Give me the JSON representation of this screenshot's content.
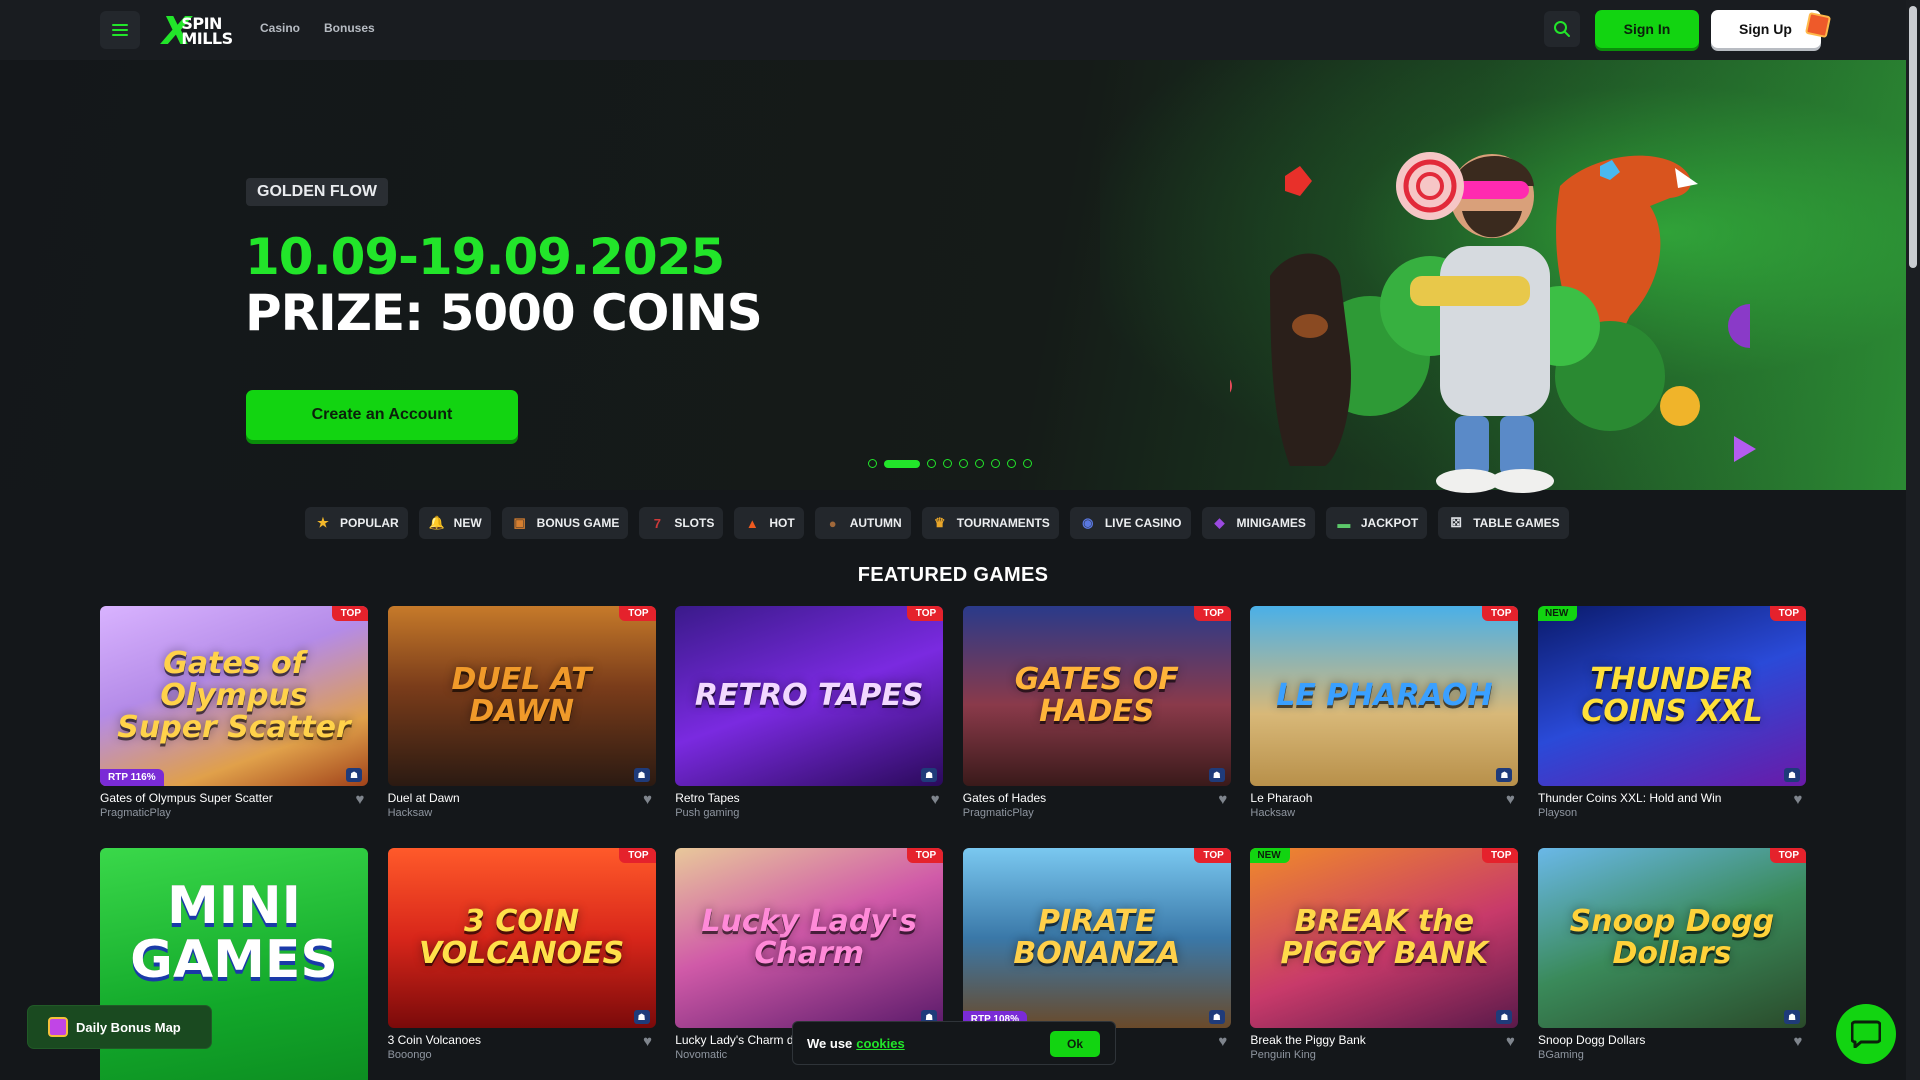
{
  "header": {
    "logo_line1": "SPIN",
    "logo_line2": "MILLS",
    "nav": [
      "Casino",
      "Bonuses"
    ],
    "signin_label": "Sign In",
    "signup_label": "Sign Up"
  },
  "hero": {
    "tag": "GOLDEN FLOW",
    "dates": "10.09-19.09.2025",
    "prize": "PRIZE: 5000 COINS",
    "cta": "Create an Account",
    "slides_total": 9,
    "active_slide": 2
  },
  "categories": [
    {
      "label": "POPULAR",
      "icon": "star-icon",
      "glyph": "★",
      "color": "#f2b72a"
    },
    {
      "label": "NEW",
      "icon": "bell-icon",
      "glyph": "🔔",
      "color": "#e8b040"
    },
    {
      "label": "BONUS GAME",
      "icon": "treasure-chest-icon",
      "glyph": "▣",
      "color": "#d67f30"
    },
    {
      "label": "SLOTS",
      "icon": "slot-machine-icon",
      "glyph": "7",
      "color": "#cf3a3a"
    },
    {
      "label": "HOT",
      "icon": "flame-icon",
      "glyph": "▲",
      "color": "#ef5a1f"
    },
    {
      "label": "AUTUMN",
      "icon": "acorn-icon",
      "glyph": "●",
      "color": "#a0683a"
    },
    {
      "label": "TOURNAMENTS",
      "icon": "trophy-icon",
      "glyph": "♛",
      "color": "#e8a62a"
    },
    {
      "label": "LIVE CASINO",
      "icon": "roulette-icon",
      "glyph": "◉",
      "color": "#5a78e0"
    },
    {
      "label": "MINIGAMES",
      "icon": "gem-icon",
      "glyph": "◆",
      "color": "#9b4ae0"
    },
    {
      "label": "JACKPOT",
      "icon": "cash-icon",
      "glyph": "▬",
      "color": "#5cc86a"
    },
    {
      "label": "TABLE GAMES",
      "icon": "dice-icon",
      "glyph": "⚄",
      "color": "#dfe2e6"
    }
  ],
  "section_title": "FEATURED GAMES",
  "games": [
    {
      "name": "Gates of Olympus Super Scatter",
      "provider": "PragmaticPlay",
      "art": "Gates of Olympus Super Scatter",
      "badge_top": "TOP",
      "badge_new": "",
      "rtp": "RTP 116%",
      "bg": "linear-gradient(160deg,#d9b3ff 0%,#b48be8 40%,#e0a04a 75%,#a0421a 100%)",
      "fg": "#ffd24a"
    },
    {
      "name": "Duel at Dawn",
      "provider": "Hacksaw",
      "art": "DUEL AT DAWN",
      "badge_top": "TOP",
      "badge_new": "",
      "rtp": "",
      "bg": "linear-gradient(180deg,#c67a2a 0%,#7a3c1a 45%,#2b1a12 100%)",
      "fg": "#f09a2a"
    },
    {
      "name": "Retro Tapes",
      "provider": "Push gaming",
      "art": "RETRO TAPES",
      "badge_top": "TOP",
      "badge_new": "",
      "rtp": "",
      "bg": "linear-gradient(160deg,#3a1a8a 0%,#7a2ae0 50%,#2a0a5a 100%)",
      "fg": "#f2d8ff"
    },
    {
      "name": "Gates of Hades",
      "provider": "PragmaticPlay",
      "art": "GATES OF HADES",
      "badge_top": "TOP",
      "badge_new": "",
      "rtp": "",
      "bg": "linear-gradient(180deg,#2a3a8a 0%,#8a3a4a 55%,#3a1a1a 100%)",
      "fg": "#ffb43a"
    },
    {
      "name": "Le Pharaoh",
      "provider": "Hacksaw",
      "art": "LE PHARAOH",
      "badge_top": "TOP",
      "badge_new": "",
      "rtp": "",
      "bg": "linear-gradient(180deg,#4ab0e8 0%,#d8b878 60%,#b8904a 100%)",
      "fg": "#3aa0ff"
    },
    {
      "name": "Thunder Coins XXL: Hold and Win",
      "provider": "Playson",
      "art": "THUNDER COINS XXL",
      "badge_top": "TOP",
      "badge_new": "NEW",
      "rtp": "",
      "bg": "linear-gradient(160deg,#0a1a6a 0%,#2a4ad8 50%,#6a1aa8 100%)",
      "fg": "#ffe03a"
    },
    {
      "name": "3 Coin Volcanoes",
      "provider": "Booongo",
      "art": "3 COIN VOLCANOES",
      "badge_top": "TOP",
      "badge_new": "",
      "rtp": "",
      "bg": "linear-gradient(180deg,#ff5a2a 0%,#d8261a 50%,#7a0a0a 100%)",
      "fg": "#ffe04a"
    },
    {
      "name": "Lucky Lady's Charm deluxe",
      "provider": "Novomatic",
      "art": "Lucky Lady's Charm",
      "badge_top": "TOP",
      "badge_new": "",
      "rtp": "",
      "bg": "linear-gradient(160deg,#e8c89a 0%,#d05aa8 45%,#5a1a6a 100%)",
      "fg": "#ff8ad8"
    },
    {
      "name": "Pirate Bonanza",
      "provider": "",
      "art": "PIRATE BONANZA",
      "badge_top": "TOP",
      "badge_new": "",
      "rtp": "RTP 108%",
      "bg": "linear-gradient(180deg,#7ac8f0 0%,#3a78a8 50%,#6a4a2a 100%)",
      "fg": "#ffd04a"
    },
    {
      "name": "Break the Piggy Bank",
      "provider": "Penguin King",
      "art": "BREAK the PIGGY BANK",
      "badge_top": "TOP",
      "badge_new": "NEW",
      "rtp": "",
      "bg": "linear-gradient(160deg,#f08a2a 0%,#c83a6a 55%,#5a1a4a 100%)",
      "fg": "#ffd84a"
    },
    {
      "name": "Snoop Dogg Dollars",
      "provider": "BGaming",
      "art": "Snoop Dogg Dollars",
      "badge_top": "TOP",
      "badge_new": "",
      "rtp": "",
      "bg": "linear-gradient(160deg,#6ab8e8 0%,#3a8a5a 50%,#2a4a2a 100%)",
      "fg": "#ffd23a"
    }
  ],
  "minigames_tile": "MINI GAMES",
  "bonus_map_label": "Daily Bonus Map",
  "cookie": {
    "text": "We use",
    "link": "cookies",
    "ok": "Ok"
  }
}
